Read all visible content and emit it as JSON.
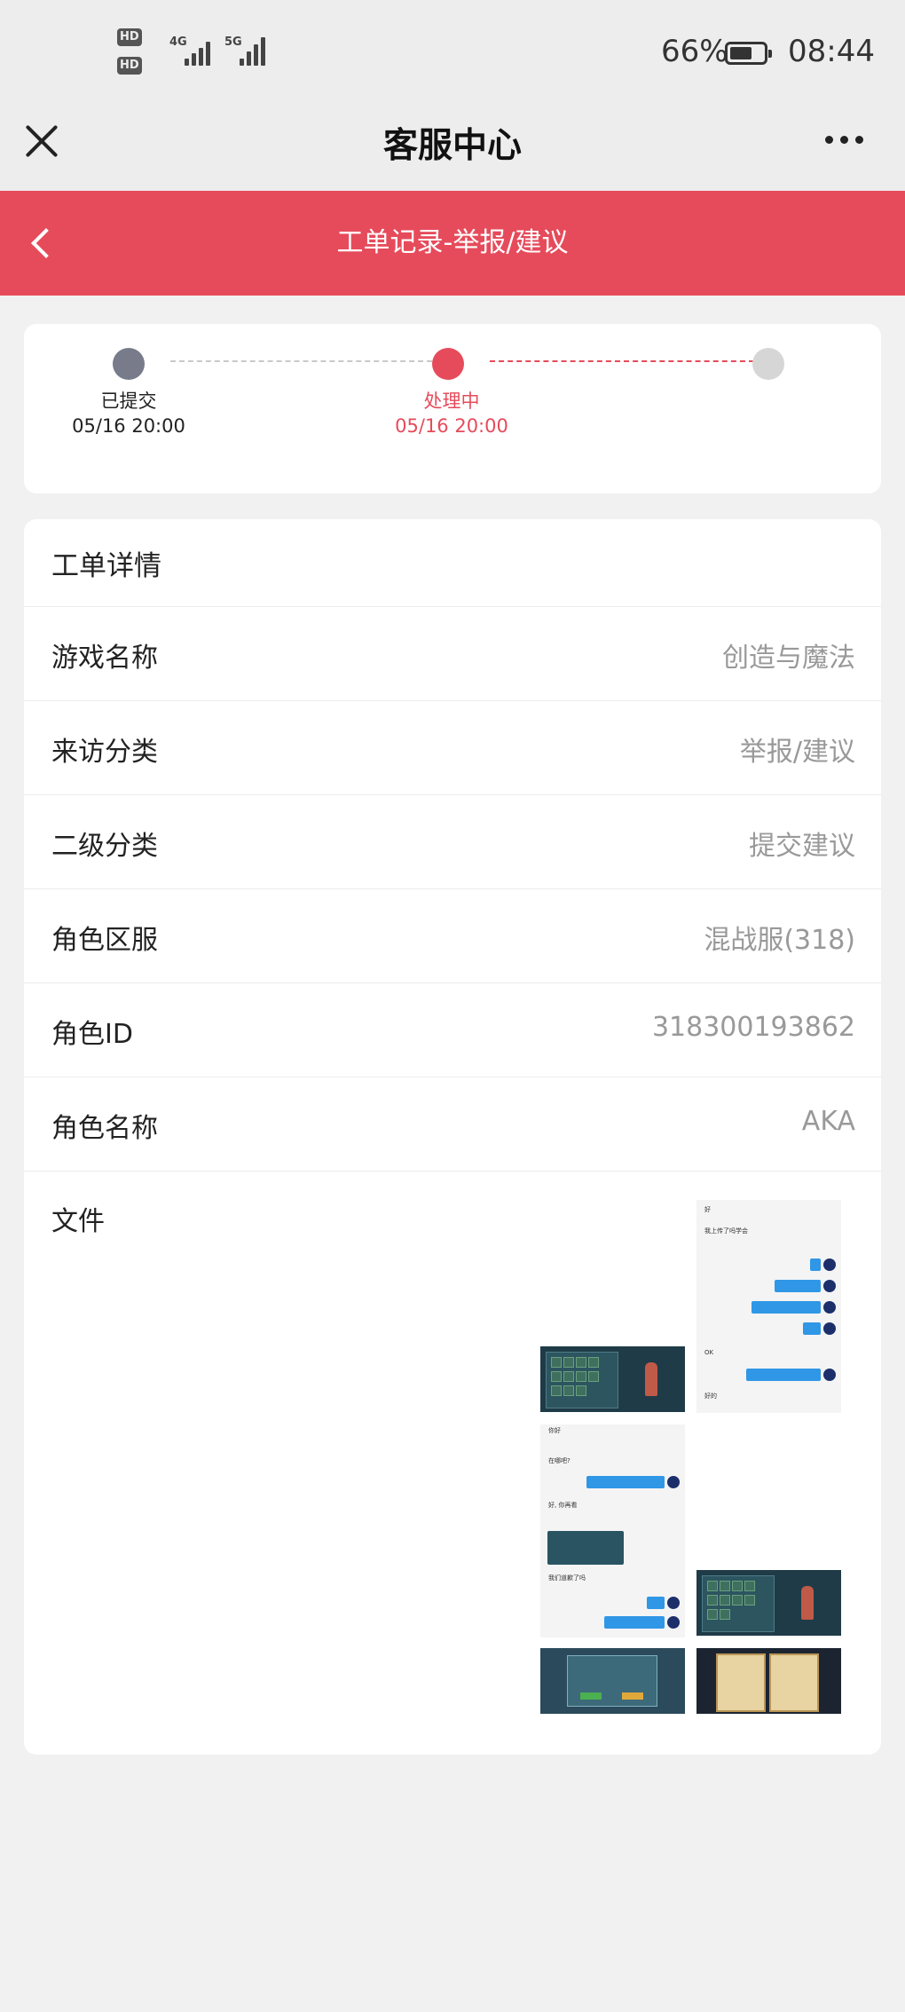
{
  "status_bar": {
    "sim1": "HD 1",
    "sim2": "HD 2",
    "net1": "4G",
    "net2": "5G",
    "battery_percent": "66%",
    "battery_level": 0.66,
    "time": "08:44"
  },
  "nav": {
    "title": "客服中心",
    "close_icon": "close-icon",
    "more_icon": "more-icon"
  },
  "header": {
    "title": "工单记录-举报/建议",
    "back_icon": "chevron-left-icon",
    "color": "#e64b5b"
  },
  "progress": {
    "steps": [
      {
        "label": "已提交",
        "time": "05/16 20:00",
        "state": "done",
        "color": "#777b8a"
      },
      {
        "label": "处理中",
        "time": "05/16 20:00",
        "state": "active",
        "color": "#e64b5b"
      },
      {
        "label": "",
        "time": "",
        "state": "pending",
        "color": "#d6d6d6"
      }
    ]
  },
  "details": {
    "header": "工单详情",
    "rows": [
      {
        "label": "游戏名称",
        "value": "创造与魔法"
      },
      {
        "label": "来访分类",
        "value": "举报/建议"
      },
      {
        "label": "二级分类",
        "value": "提交建议"
      },
      {
        "label": "角色区服",
        "value": "混战服(318)"
      },
      {
        "label": "角色ID",
        "value": "318300193862"
      },
      {
        "label": "角色名称",
        "value": "AKA"
      }
    ],
    "file_label": "文件",
    "files": {
      "chat1": {
        "lines": [
          "好",
          "我上传了吗学会",
          "好",
          "看到了的吗?",
          "那个我的等级是一下吧",
          "OK",
          "你能给上传看一下吗去吗",
          "好的"
        ]
      },
      "chat2": {
        "lines": [
          "你好",
          "在哪吧?",
          "我是说身份被的看看那玩家",
          "好, 你再看",
          "我们道歉了吗",
          "加油",
          "我一会会去问问看看"
        ]
      }
    }
  }
}
